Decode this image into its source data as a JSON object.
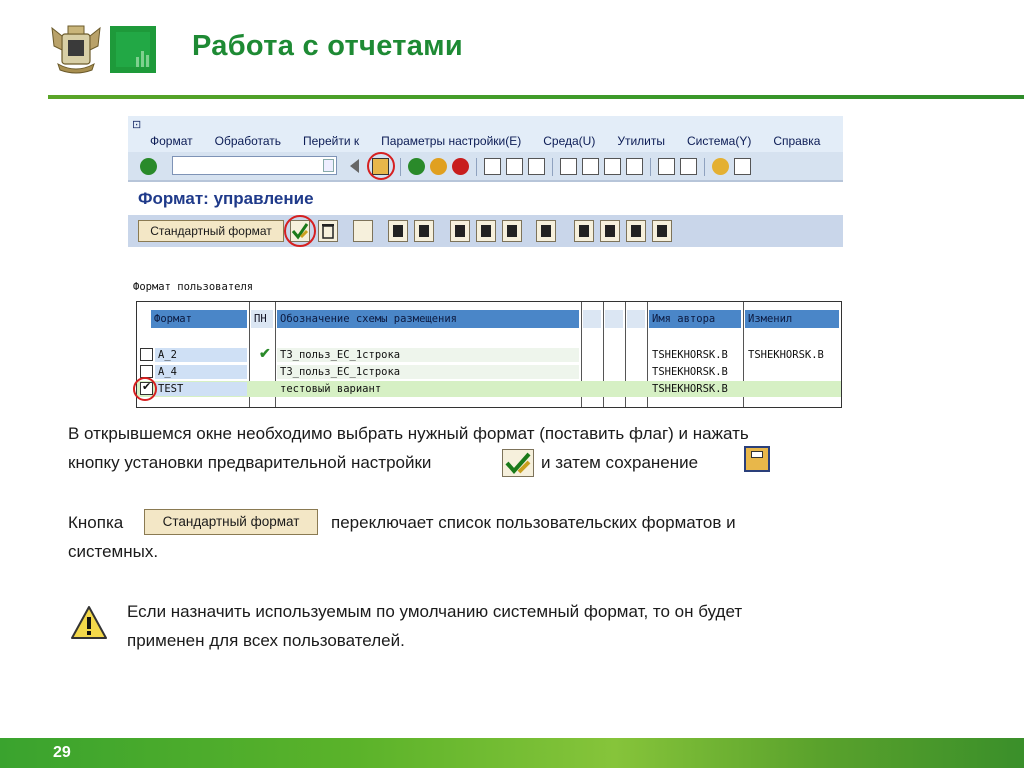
{
  "slide": {
    "title": "Работа с отчетами",
    "page_number": "29",
    "colors": {
      "accent_green": "#1e8a34",
      "sap_blue": "#1f3a8a",
      "highlight_red": "#d62020"
    }
  },
  "sap": {
    "menu": [
      "Формат",
      "Обработать",
      "Перейти к",
      "Параметры настройки(E)",
      "Среда(U)",
      "Утилиты",
      "Система(Y)",
      "Справка"
    ],
    "window_title": "Формат: управление",
    "standard_button": "Стандартный формат",
    "section_label": "Формат пользователя",
    "table": {
      "headers": [
        "Формат",
        "ПН",
        "Обозначение схемы размещения",
        "Имя автора",
        "Изменил"
      ],
      "rows": [
        {
          "format": "A_2",
          "checked": false,
          "default": true,
          "description": "ТЗ_польз_ЕС_1строка",
          "author": "TSHEKHORSK.B",
          "changed": "TSHEKHORSK.B"
        },
        {
          "format": "A_4",
          "checked": false,
          "default": false,
          "description": "ТЗ_польз_ЕС_1строка",
          "author": "TSHEKHORSK.B",
          "changed": ""
        },
        {
          "format": "TEST",
          "checked": true,
          "default": false,
          "description": "тестовый вариант",
          "author": "TSHEKHORSK.B",
          "changed": ""
        }
      ]
    }
  },
  "text": {
    "p1_line1": "В открывшемся окне необходимо выбрать нужный формат (поставить флаг) и нажать",
    "p1_line2a": "кнопку установки предварительной настройки",
    "p1_line2b": "и затем сохранение",
    "p2_a": "Кнопка",
    "p2_button": "Стандартный формат",
    "p2_b": "переключает список пользовательских  форматов и",
    "p2_line2": "системных.",
    "note_line1": "Если назначить используемым по умолчанию системный формат, то он будет",
    "note_line2": "применен для всех пользователей."
  }
}
